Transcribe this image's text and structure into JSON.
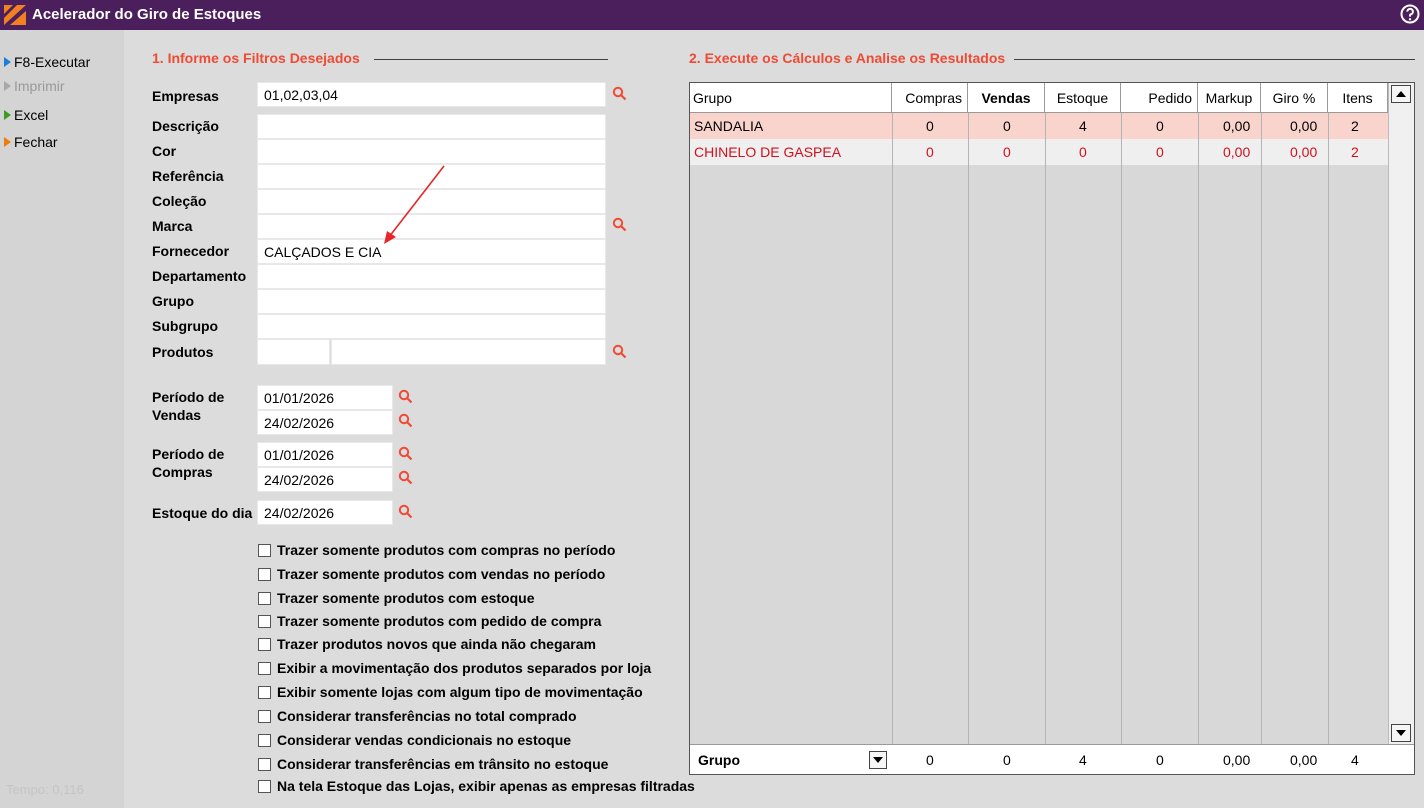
{
  "window": {
    "title": "Acelerador do Giro de Estoques"
  },
  "sidebar": {
    "items": [
      {
        "label": "F8-Executar",
        "icon": "play-icon",
        "color": "#1e7fd8"
      },
      {
        "label": "Imprimir",
        "icon": "play-icon",
        "color": "#a8a8a8"
      },
      {
        "label": "Excel",
        "icon": "play-icon",
        "color": "#3a9d23"
      },
      {
        "label": "Fechar",
        "icon": "play-icon",
        "color": "#f07b0c"
      }
    ],
    "tempo": "Tempo:  0,116"
  },
  "section1": {
    "title": "1. Informe os Filtros Desejados"
  },
  "section2": {
    "title": "2. Execute os Cálculos e Analise os Resultados"
  },
  "filters": {
    "empresas": {
      "label": "Empresas",
      "value": "01,02,03,04"
    },
    "descricao": {
      "label": "Descrição",
      "value": ""
    },
    "cor": {
      "label": "Cor",
      "value": ""
    },
    "referencia": {
      "label": "Referência",
      "value": ""
    },
    "colecao": {
      "label": "Coleção",
      "value": ""
    },
    "marca": {
      "label": "Marca",
      "value": ""
    },
    "fornecedor": {
      "label": "Fornecedor",
      "value": "CALÇADOS E CIA"
    },
    "departamento": {
      "label": "Departamento",
      "value": ""
    },
    "grupo": {
      "label": "Grupo",
      "value": ""
    },
    "subgrupo": {
      "label": "Subgrupo",
      "value": ""
    },
    "produtos": {
      "label": "Produtos",
      "value": ""
    }
  },
  "periods": {
    "vendas": {
      "label1": "Período de",
      "label2": "Vendas",
      "from": "01/01/2026",
      "to": "24/02/2026"
    },
    "compras": {
      "label1": "Período de",
      "label2": "Compras",
      "from": "01/01/2026",
      "to": "24/02/2026"
    },
    "estoque": {
      "label": "Estoque do dia",
      "value": "24/02/2026"
    }
  },
  "options": [
    "Trazer somente produtos com compras no período",
    "Trazer somente produtos com vendas no período",
    "Trazer somente produtos com estoque",
    "Trazer somente produtos com pedido de compra",
    "Trazer produtos novos que ainda não chegaram",
    "Exibir a movimentação dos produtos separados por loja",
    "Exibir somente lojas com algum tipo de movimentação",
    "Considerar transferências no total comprado",
    "Considerar vendas condicionais no estoque",
    "Considerar transferências em trânsito no estoque",
    "Na tela Estoque das Lojas, exibir apenas as empresas filtradas"
  ],
  "grid": {
    "columns": [
      "Grupo",
      "Compras",
      "Vendas",
      "Estoque",
      "Pedido",
      "Markup",
      "Giro %",
      "Itens"
    ],
    "rows": [
      [
        "SANDALIA",
        "0",
        "0",
        "4",
        "0",
        "0,00",
        "0,00",
        "2"
      ],
      [
        "CHINELO DE GASPEA",
        "0",
        "0",
        "0",
        "0",
        "0,00",
        "0,00",
        "2"
      ]
    ],
    "footer": {
      "group_select": "Grupo",
      "values": [
        "0",
        "0",
        "4",
        "0",
        "0,00",
        "0,00",
        "4"
      ]
    }
  },
  "colors": {
    "titlebar": "#4b1e5c",
    "accent": "#f04a34",
    "row_highlight": "#f9d4cc",
    "row_text_alert": "#d0101e"
  }
}
